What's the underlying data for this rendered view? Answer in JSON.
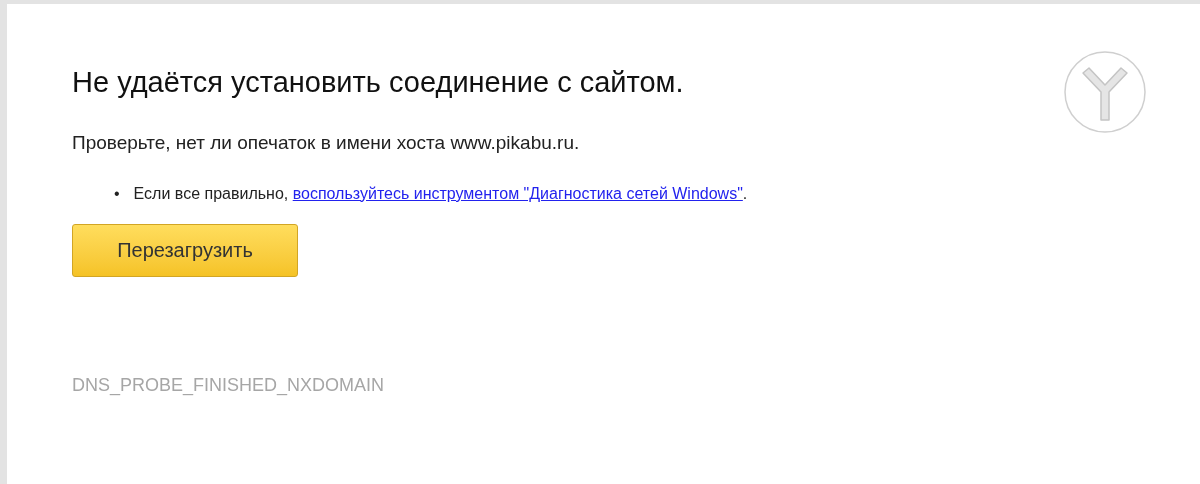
{
  "title": "Не удаётся установить соединение с сайтом.",
  "message": "Проверьте, нет ли опечаток в имени хоста www.pikabu.ru.",
  "suggestions": [
    {
      "bullet": "•",
      "text": "Если все правильно, ",
      "link": "воспользуйтесь инструментом \"Диагностика сетей Windows\"",
      "end": "."
    }
  ],
  "reload_button": "Перезагрузить",
  "error_code": "DNS_PROBE_FINISHED_NXDOMAIN"
}
